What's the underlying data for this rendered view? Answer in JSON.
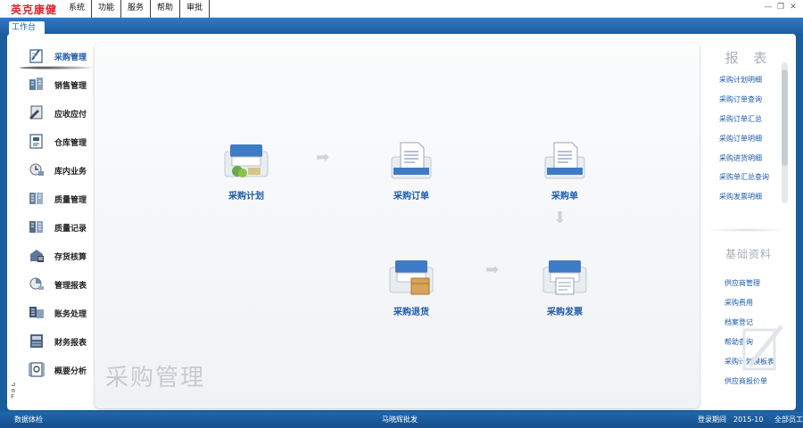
{
  "app": {
    "brand": "英克康健"
  },
  "menu": [
    {
      "label": "系统"
    },
    {
      "label": "功能"
    },
    {
      "label": "服务"
    },
    {
      "label": "帮助"
    },
    {
      "label": "审批"
    }
  ],
  "window_controls": {
    "minimize": "—",
    "restore": "❐",
    "close": "✕"
  },
  "tab": {
    "label": "工作台"
  },
  "sidebar": {
    "items": [
      {
        "label": "采购管理",
        "icon": "purchase-icon"
      },
      {
        "label": "销售管理",
        "icon": "sales-icon"
      },
      {
        "label": "应收应付",
        "icon": "receivable-icon"
      },
      {
        "label": "仓库管理",
        "icon": "warehouse-icon"
      },
      {
        "label": "库内业务",
        "icon": "stock-business-icon"
      },
      {
        "label": "质量管理",
        "icon": "quality-icon"
      },
      {
        "label": "质量记录",
        "icon": "quality-record-icon"
      },
      {
        "label": "存货核算",
        "icon": "inventory-accounting-icon"
      },
      {
        "label": "管理报表",
        "icon": "management-report-icon"
      },
      {
        "label": "账务处理",
        "icon": "accounting-icon"
      },
      {
        "label": "财务报表",
        "icon": "finance-report-icon"
      },
      {
        "label": "概要分析",
        "icon": "summary-analysis-icon"
      }
    ],
    "tools": [
      "⊿",
      "≡",
      "F"
    ]
  },
  "main": {
    "watermark": "采购管理",
    "flow": [
      {
        "label": "采购计划",
        "icon": "purchase-plan-icon"
      },
      {
        "label": "采购订单",
        "icon": "purchase-order-icon"
      },
      {
        "label": "采购单",
        "icon": "purchase-receipt-icon"
      },
      {
        "label": "采购退货",
        "icon": "purchase-return-icon"
      },
      {
        "label": "采购发票",
        "icon": "purchase-invoice-icon"
      }
    ]
  },
  "reports": {
    "title": "报 表",
    "items": [
      {
        "label": "采购计划明细"
      },
      {
        "label": "采购订单查询"
      },
      {
        "label": "采购订单汇总"
      },
      {
        "label": "采购订单明细"
      },
      {
        "label": "采购进货明细"
      },
      {
        "label": "采购单汇总查询"
      },
      {
        "label": "采购发票明细"
      }
    ]
  },
  "basic": {
    "title": "基础资料",
    "items": [
      {
        "label": "供应商管理"
      },
      {
        "label": "采购费用"
      },
      {
        "label": "档案登记"
      },
      {
        "label": "帮助查询"
      },
      {
        "label": "采购计划模板表"
      },
      {
        "label": "供应商报价单"
      }
    ]
  },
  "status": {
    "left": "数据体检",
    "center": "马晓辉批发",
    "login_label": "登录期间",
    "login_value": "2015-10",
    "right": "全部员工"
  },
  "colors": {
    "brand_red": "#d8262d",
    "blue_bar": "#1b5ea3",
    "link_blue": "#1c5aa8"
  }
}
